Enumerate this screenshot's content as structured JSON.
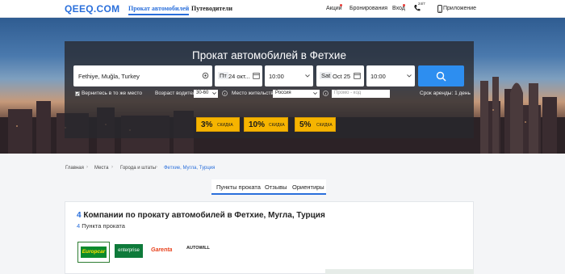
{
  "header": {
    "logo": "QEEQ.COM",
    "nav": [
      "Прокат автомобилей",
      "Путеводители"
    ],
    "right": {
      "deals": "Акции",
      "bookings": "Бронирования",
      "login": "Вход",
      "phone_badge": "24/7",
      "app": "Приложение"
    }
  },
  "search": {
    "title": "Прокат автомобилей в Фетхие",
    "location": "Fethiye, Muğla, Turkey",
    "pickup_weekday": "Пт",
    "pickup_date": "24 окт...",
    "pickup_time": "10:00",
    "return_weekday": "Sat",
    "return_date": "Oct 25",
    "return_time": "10:00",
    "same_place_label": "Вернитесь в то же место",
    "driver_age_label": "Возраст водителя:",
    "driver_age_value": "30-60",
    "residence_label": "Место жительства:",
    "residence_value": "Россия",
    "promo_placeholder": "Промо - код",
    "rental_term": "Срок аренды: 1 день"
  },
  "discounts": [
    {
      "value": "3%",
      "label": "СКИДКА"
    },
    {
      "value": "10%",
      "label": "СКИДКА"
    },
    {
      "value": "5%",
      "label": "СКИДКА"
    }
  ],
  "breadcrumb": [
    "Главная",
    "Места",
    "Города и штаты",
    "Фетхие, Мугла, Турция"
  ],
  "tabs": [
    "Пункты проката",
    "Отзывы",
    "Ориентиры"
  ],
  "companies": {
    "count": "4",
    "heading": "Компании по прокату автомобилей в Фетхие, Мугла, Турция",
    "points_count": "4",
    "points_label": "Пункта проката",
    "brands": [
      "Europcar",
      "enterprise",
      "Garenta",
      "AUTOWILL"
    ]
  },
  "colors": {
    "accent": "#2a6fdb",
    "search_button": "#2d8ef0",
    "discount": "#f6b400"
  }
}
